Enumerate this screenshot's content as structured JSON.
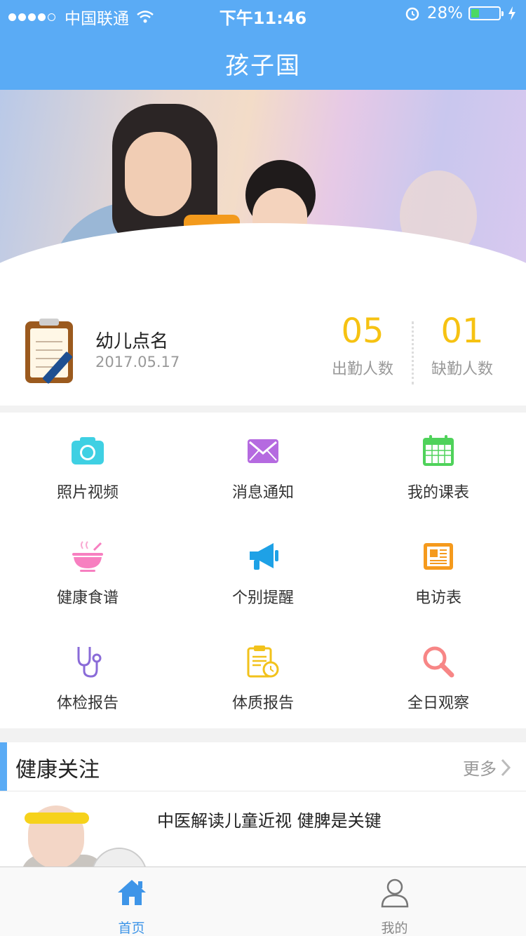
{
  "status_bar": {
    "carrier": "中国联通",
    "time": "下午11:46",
    "battery_percent": "28%",
    "battery_level": 0.28,
    "icons": [
      "signal-dots-icon",
      "wifi-icon",
      "alarm-icon",
      "battery-icon",
      "charging-icon"
    ]
  },
  "nav": {
    "title": "孩子国"
  },
  "attendance": {
    "title": "幼儿点名",
    "date": "2017.05.17",
    "present_count": "05",
    "present_label": "出勤人数",
    "absent_count": "01",
    "absent_label": "缺勤人数",
    "icon": "clipboard-icon"
  },
  "menu": [
    {
      "label": "照片视频",
      "icon": "camera-icon",
      "color": "#3fd0e3"
    },
    {
      "label": "消息通知",
      "icon": "envelope-icon",
      "color": "#b56ae0"
    },
    {
      "label": "我的课表",
      "icon": "calendar-icon",
      "color": "#4fd25a"
    },
    {
      "label": "健康食谱",
      "icon": "bowl-icon",
      "color": "#f77fc0"
    },
    {
      "label": "个别提醒",
      "icon": "megaphone-icon",
      "color": "#1ea1e6"
    },
    {
      "label": "电访表",
      "icon": "newspaper-icon",
      "color": "#f59a1d"
    },
    {
      "label": "体检报告",
      "icon": "stethoscope-icon",
      "color": "#8a6bd8"
    },
    {
      "label": "体质报告",
      "icon": "report-clock-icon",
      "color": "#f2c21b"
    },
    {
      "label": "全日观察",
      "icon": "magnifier-icon",
      "color": "#f78686"
    }
  ],
  "health": {
    "title": "健康关注",
    "more": "更多",
    "articles": [
      {
        "title": "中医解读儿童近视 健脾是关键"
      }
    ]
  },
  "tabs": [
    {
      "label": "首页",
      "icon": "home-icon",
      "active": true
    },
    {
      "label": "我的",
      "icon": "person-icon",
      "active": false
    }
  ],
  "colors": {
    "primary": "#5aabf5",
    "accent_number": "#f6c212",
    "tab_active": "#3e95e8"
  }
}
